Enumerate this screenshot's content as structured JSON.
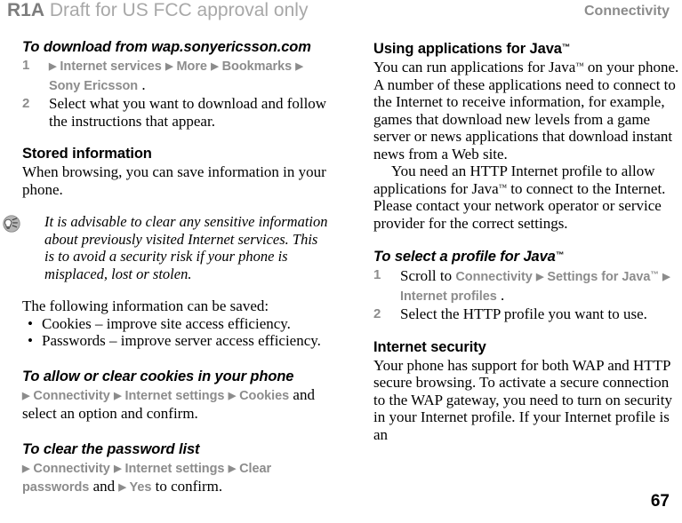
{
  "header": {
    "revision": "R1A",
    "draft_notice": "Draft for US FCC approval only",
    "chapter": "Connectivity"
  },
  "footer": {
    "page_number": "67"
  },
  "left_column": {
    "proc_download": {
      "heading": "To download from wap.sonyericsson.com",
      "steps": [
        {
          "number": "1",
          "parts": [
            {
              "type": "arrow"
            },
            {
              "type": "menu",
              "text": "Internet services"
            },
            {
              "type": "arrow"
            },
            {
              "type": "menu",
              "text": "More"
            },
            {
              "type": "arrow"
            },
            {
              "type": "menu",
              "text": "Bookmarks"
            },
            {
              "type": "arrow"
            },
            {
              "type": "menu",
              "text": "Sony Ericsson"
            },
            {
              "type": "serif",
              "text": "."
            }
          ]
        },
        {
          "number": "2",
          "parts": [
            {
              "type": "serif",
              "text": "Select what you want to download and follow the instructions that appear."
            }
          ]
        }
      ]
    },
    "sect_stored": {
      "heading": "Stored information",
      "body": "When browsing, you can save information in your phone.",
      "note_icon": "lightbulb-tip-icon",
      "note": "It is advisable to clear any sensitive information about previously visited Internet services. This is to avoid a security risk if your phone is misplaced, lost or stolen.",
      "list_intro": "The following information can be saved:",
      "bullets": [
        "Cookies – improve site access efficiency.",
        "Passwords – improve server access efficiency."
      ]
    },
    "proc_cookies": {
      "heading": "To allow or clear cookies in your phone",
      "parts": [
        {
          "type": "arrow"
        },
        {
          "type": "menu",
          "text": "Connectivity"
        },
        {
          "type": "arrow"
        },
        {
          "type": "menu",
          "text": "Internet settings"
        },
        {
          "type": "arrow"
        },
        {
          "type": "menu",
          "text": "Cookies"
        },
        {
          "type": "serif",
          "text": " and select an option and confirm."
        }
      ]
    },
    "proc_passwords": {
      "heading": "To clear the password list",
      "parts": [
        {
          "type": "arrow"
        },
        {
          "type": "menu",
          "text": "Connectivity"
        },
        {
          "type": "arrow"
        },
        {
          "type": "menu",
          "text": "Internet settings"
        },
        {
          "type": "arrow"
        },
        {
          "type": "menu",
          "text": "Clear passwords"
        },
        {
          "type": "serif",
          "text": " and "
        },
        {
          "type": "arrow"
        },
        {
          "type": "menu",
          "text": "Yes"
        },
        {
          "type": "serif",
          "text": " to confirm."
        }
      ]
    }
  },
  "right_column": {
    "sect_java": {
      "heading_pre": "Using applications for Java",
      "heading_tm": "™",
      "para1_a": "You can run applications for Java",
      "para1_tm": "™",
      "para1_b": " on your phone. A number of these applications need to connect to the Internet to receive information, for example, games that download new levels from a game server or news applications that download instant news from a Web site.",
      "para2_a": "You need an HTTP Internet profile to allow applications for Java",
      "para2_tm": "™",
      "para2_b": " to connect to the Internet. Please contact your network operator or service provider for the correct settings."
    },
    "proc_profile": {
      "heading_pre": "To select a profile for Java",
      "heading_tm": "™",
      "steps": [
        {
          "number": "1",
          "parts": [
            {
              "type": "serif",
              "text": "Scroll to "
            },
            {
              "type": "menu",
              "text": "Connectivity"
            },
            {
              "type": "arrow"
            },
            {
              "type": "menu",
              "text": "Settings for Java",
              "tm": "™"
            },
            {
              "type": "arrow"
            },
            {
              "type": "menu",
              "text": "Internet profiles"
            },
            {
              "type": "serif",
              "text": "."
            }
          ]
        },
        {
          "number": "2",
          "parts": [
            {
              "type": "serif",
              "text": "Select the HTTP profile you want to use."
            }
          ]
        }
      ]
    },
    "sect_security": {
      "heading": "Internet security",
      "body": "Your phone has support for both WAP and HTTP secure browsing. To activate a secure connection to the WAP gateway, you need to turn on security in your Internet profile. If your Internet profile is an"
    }
  },
  "colors": {
    "gray_menu": "#8c8c8c",
    "gray_draft": "#a8a8a8",
    "gray_revision": "#7d7d7d",
    "text": "#000000"
  }
}
